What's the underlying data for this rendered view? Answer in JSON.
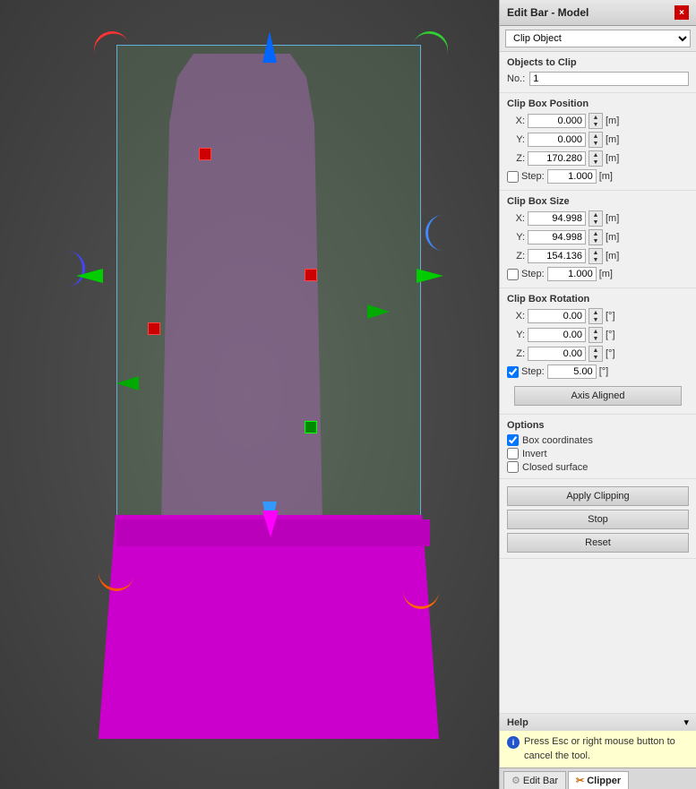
{
  "panel": {
    "title": "Edit Bar - Model",
    "close_label": "×",
    "clip_object_label": "Clip Object",
    "sections": {
      "objects_to_clip": {
        "title": "Objects to Clip",
        "no_label": "No.:",
        "no_value": "1"
      },
      "clip_box_position": {
        "title": "Clip Box Position",
        "x_label": "X:",
        "x_value": "0.000",
        "y_label": "Y:",
        "y_value": "0.000",
        "z_label": "Z:",
        "z_value": "170.280",
        "unit": "[m]",
        "step_checked": false,
        "step_label": "Step:",
        "step_value": "1.000",
        "step_unit": "[m]"
      },
      "clip_box_size": {
        "title": "Clip Box Size",
        "x_label": "X:",
        "x_value": "94.998",
        "y_label": "Y:",
        "y_value": "94.998",
        "z_label": "Z:",
        "z_value": "154.136",
        "unit": "[m]",
        "step_checked": false,
        "step_label": "Step:",
        "step_value": "1.000",
        "step_unit": "[m]"
      },
      "clip_box_rotation": {
        "title": "Clip Box Rotation",
        "x_label": "X:",
        "x_value": "0.00",
        "y_label": "Y:",
        "y_value": "0.00",
        "z_label": "Z:",
        "z_value": "0.00",
        "unit": "[°]",
        "step_checked": true,
        "step_label": "Step:",
        "step_value": "5.00",
        "step_unit": "[°]"
      },
      "axis_aligned_label": "Axis Aligned"
    },
    "options": {
      "title": "Options",
      "box_coordinates_checked": true,
      "box_coordinates_label": "Box coordinates",
      "invert_checked": false,
      "invert_label": "Invert",
      "closed_surface_checked": false,
      "closed_surface_label": "Closed surface"
    },
    "buttons": {
      "apply_clipping": "Apply Clipping",
      "stop": "Stop",
      "reset": "Reset"
    },
    "help": {
      "title": "Help",
      "icon": "i",
      "text": "Press Esc or right mouse button to cancel the tool."
    },
    "tabs": {
      "edit_bar_label": "Edit Bar",
      "clipper_label": "Clipper"
    }
  }
}
